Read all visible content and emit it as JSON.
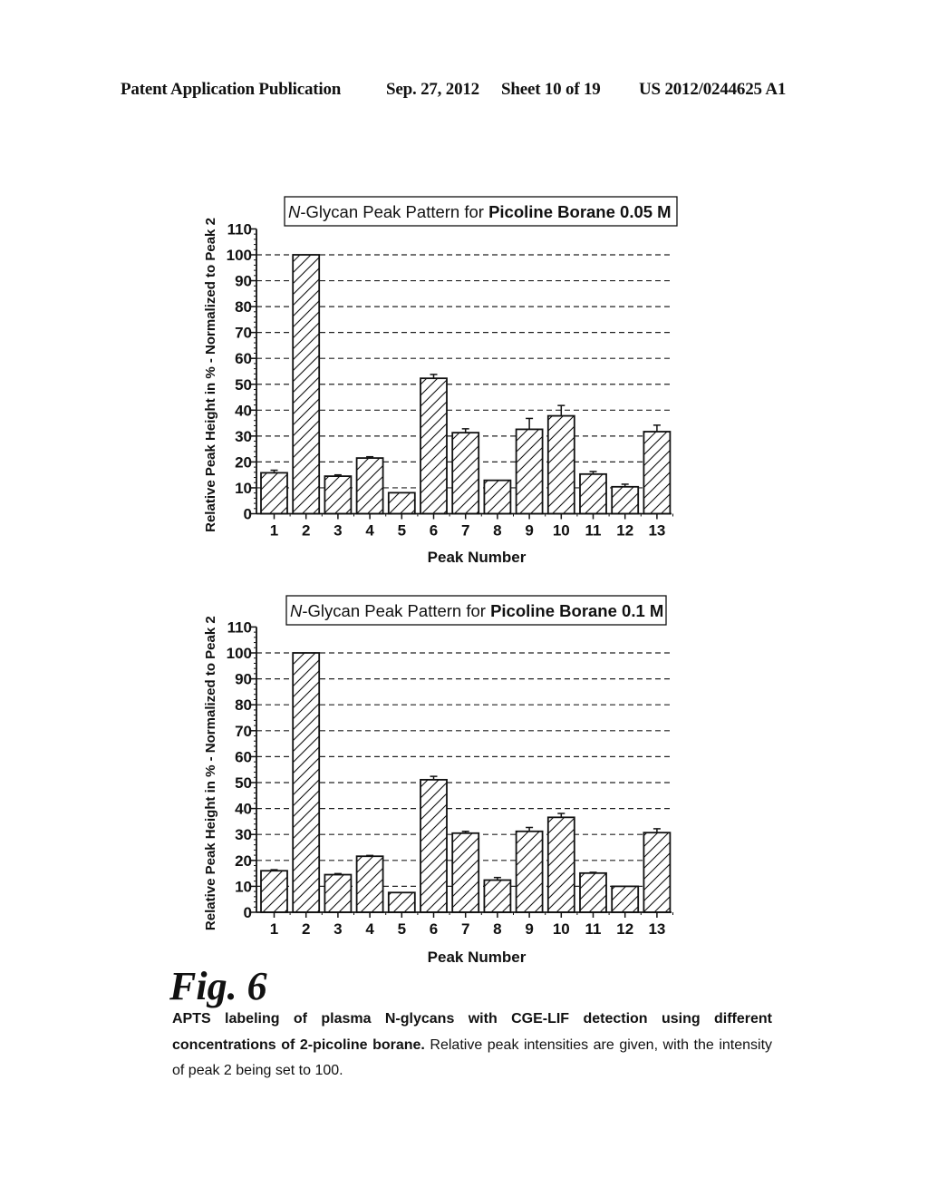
{
  "header": {
    "publication": "Patent Application Publication",
    "date": "Sep. 27, 2012",
    "sheet": "Sheet 10 of 19",
    "number": "US 2012/0244625 A1"
  },
  "figure": {
    "label": "Fig. 6",
    "caption_bold": "APTS labeling of plasma N-glycans with CGE-LIF detection using different concentrations of 2-picoline borane.",
    "caption_rest": " Relative peak intensities are given, with the intensity of peak 2 being set to 100."
  },
  "chart_data": [
    {
      "type": "bar",
      "title_italic": "N",
      "title_plain": "-Glycan Peak Pattern for ",
      "title_bold": "Picoline Borane 0.05 M",
      "xlabel": "Peak Number",
      "ylabel": "Relative Peak Height in % - Normalized to Peak 2",
      "categories": [
        "1",
        "2",
        "3",
        "4",
        "5",
        "6",
        "7",
        "8",
        "9",
        "10",
        "11",
        "12",
        "13"
      ],
      "values": [
        15.8,
        100,
        14.5,
        21.5,
        8.1,
        52.3,
        31.3,
        12.9,
        32.6,
        37.8,
        15.3,
        10.4,
        31.7
      ],
      "errors": [
        1.0,
        0,
        0.5,
        0.5,
        0,
        1.5,
        1.5,
        0,
        4.2,
        4.0,
        1.0,
        1.0,
        2.5
      ],
      "ylim": [
        0,
        110
      ],
      "yticks": [
        0,
        10,
        20,
        30,
        40,
        50,
        60,
        70,
        80,
        90,
        100,
        110
      ],
      "grid": "dashed horizontal at 10-100",
      "pattern": "diagonal hatch"
    },
    {
      "type": "bar",
      "title_italic": "N",
      "title_plain": "-Glycan Peak Pattern for ",
      "title_bold": "Picoline Borane 0.1 M",
      "xlabel": "Peak Number",
      "ylabel": "Relative Peak Height in % - Normalized to Peak 2",
      "categories": [
        "1",
        "2",
        "3",
        "4",
        "5",
        "6",
        "7",
        "8",
        "9",
        "10",
        "11",
        "12",
        "13"
      ],
      "values": [
        16.0,
        100,
        14.5,
        21.6,
        7.6,
        51.1,
        30.5,
        12.4,
        31.2,
        36.6,
        15.1,
        10.0,
        30.7
      ],
      "errors": [
        0.4,
        0,
        0.4,
        0.3,
        0,
        1.3,
        0.7,
        1.0,
        1.5,
        1.5,
        0.3,
        0,
        1.5
      ],
      "ylim": [
        0,
        110
      ],
      "yticks": [
        0,
        10,
        20,
        30,
        40,
        50,
        60,
        70,
        80,
        90,
        100,
        110
      ],
      "grid": "dashed horizontal at 10-100",
      "pattern": "diagonal hatch"
    }
  ]
}
